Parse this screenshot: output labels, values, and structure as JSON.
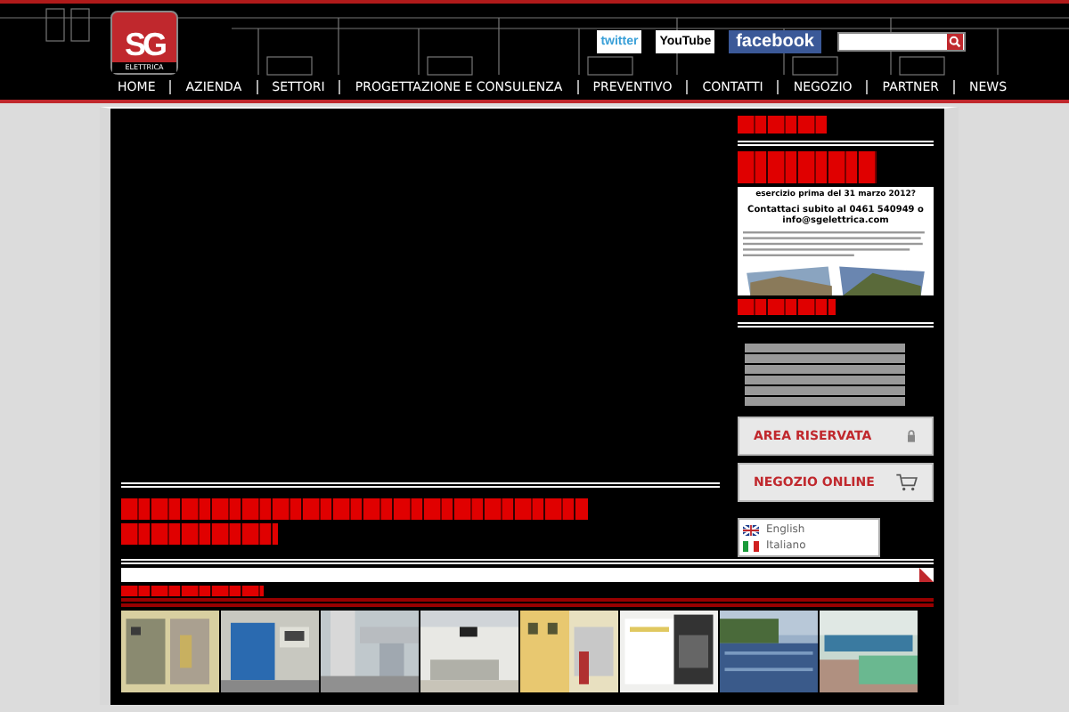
{
  "logo": {
    "mark": "SG",
    "name": "ELETTRICA"
  },
  "social": [
    {
      "kind": "twitter",
      "label": "twitter"
    },
    {
      "kind": "youtube",
      "label": "YouTube"
    },
    {
      "kind": "facebook",
      "label": "facebook"
    }
  ],
  "nav": [
    "HOME",
    "AZIENDA",
    "SETTORI",
    "PROGETTAZIONE E CONSULENZA",
    "PREVENTIVO",
    "CONTATTI",
    "NEGOZIO",
    "PARTNER",
    "NEWS"
  ],
  "promo": {
    "title": "esercizio prima del 31 marzo 2012?",
    "contact": "Contattaci subito al 0461 540949 o info@sgelettrica.com"
  },
  "side_buttons": [
    {
      "label": "AREA RISERVATA",
      "kind": "lock"
    },
    {
      "label": "NEGOZIO ONLINE",
      "kind": "cart"
    }
  ],
  "languages": [
    {
      "label": "English",
      "kind": "uk"
    },
    {
      "label": "Italiano",
      "kind": "it"
    }
  ],
  "thumbnails": [
    {
      "kind": "panel"
    },
    {
      "kind": "machine"
    },
    {
      "kind": "pipes"
    },
    {
      "kind": "room"
    },
    {
      "kind": "building"
    },
    {
      "kind": "screen"
    },
    {
      "kind": "solar"
    },
    {
      "kind": "tank"
    }
  ]
}
